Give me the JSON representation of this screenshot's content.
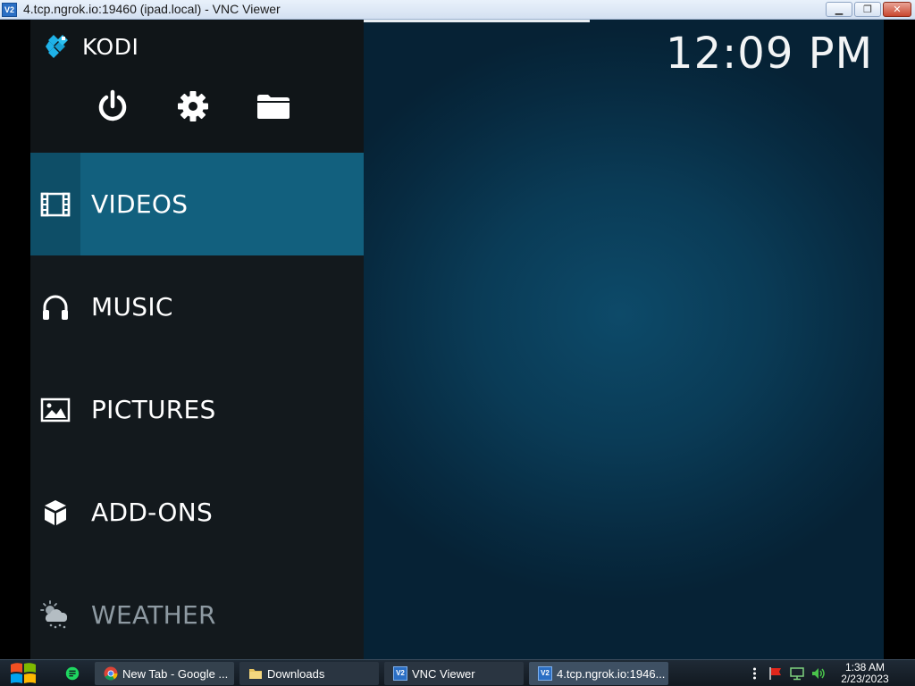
{
  "window": {
    "title": "4.tcp.ngrok.io:19460 (ipad.local) - VNC Viewer",
    "icon_text": "V2",
    "minimize_glyph": "▁",
    "maximize_glyph": "❐",
    "close_glyph": "✕"
  },
  "kodi": {
    "logo_text": "KODI",
    "clock": "12:09 PM",
    "quick_actions": [
      {
        "name": "power",
        "icon": "power-icon"
      },
      {
        "name": "settings",
        "icon": "gear-icon"
      },
      {
        "name": "file-manager",
        "icon": "folder-icon"
      }
    ],
    "menu": [
      {
        "label": "VIDEOS",
        "icon": "film-icon",
        "active": true
      },
      {
        "label": "MUSIC",
        "icon": "headphones-icon",
        "active": false
      },
      {
        "label": "PICTURES",
        "icon": "picture-icon",
        "active": false
      },
      {
        "label": "ADD-ONS",
        "icon": "box-icon",
        "active": false
      },
      {
        "label": "WEATHER",
        "icon": "weather-icon",
        "active": false
      }
    ],
    "colors": {
      "active_item": "#12607e",
      "sidebar": "#13191d",
      "background": "#0a3b56"
    }
  },
  "taskbar": {
    "tasks": [
      {
        "label": "New Tab - Google ...",
        "icon": "chrome-icon"
      },
      {
        "label": "Downloads",
        "icon": "folder-icon"
      },
      {
        "label": "VNC Viewer",
        "icon": "vnc-icon"
      },
      {
        "label": "4.tcp.ngrok.io:1946...",
        "icon": "vnc-icon",
        "active": true
      }
    ],
    "vnc_icon_text": "V2",
    "clock_time": "1:38 AM",
    "clock_date": "2/23/2023"
  }
}
